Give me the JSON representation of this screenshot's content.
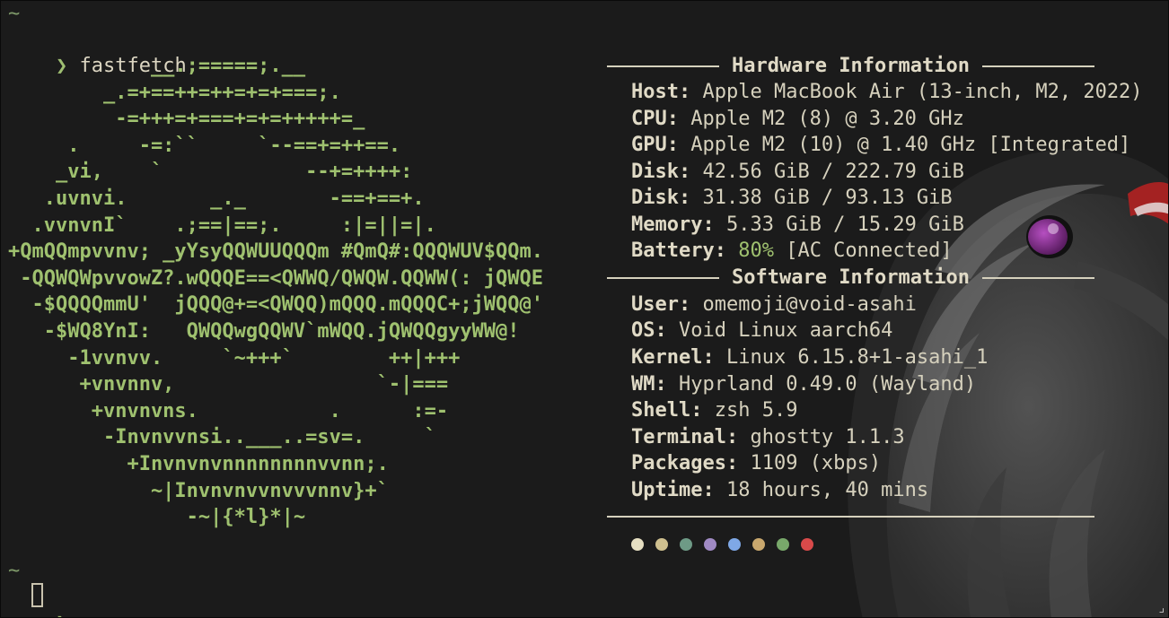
{
  "prompt": {
    "tilde": "~",
    "arrow": "❯",
    "command": "fastfetch"
  },
  "ascii_logo": [
    "            __.;=====;.__",
    "        _.=+==++=++=+=+===;.",
    "         -=+++=+===+=+=+++++=_",
    "     .     -=:``     `--==+=++==.",
    "    _vi,    `            --+=++++:",
    "   .uvnvi.       _._       -==+==+.",
    "  .vvnvnI`    .;==|==;.     :|=||=|.",
    "+QmQQmpvvnv; _yYsyQQWUUQQQm #QmQ#:QQQWUV$QQm.",
    " -QQWQWpvvowZ?.wQQQE==<QWWQ/QWQW.QQWW(: jQWQE",
    "  -$QQQQmmU'  jQQQ@+=<QWQQ)mQQQ.mQQQC+;jWQQ@'",
    "   -$WQ8YnI:   QWQQwgQQWV`mWQQ.jQWQQgyyWW@!",
    "     -1vvnvv.     `~+++`        ++|+++",
    "      +vnvnnv,                 `-|===",
    "       +vnvnvns.           .      :=-",
    "        -Invnvvnsi..___..=sv=.     `",
    "          +Invnvnvnnnnnnnnvvnn;.",
    "            ~|Invnvnvvnvvvnnv}+`",
    "               -~|{*l}*|~"
  ],
  "hardware": {
    "header": "Hardware Information",
    "rows": [
      {
        "key": "Host:",
        "value": " Apple MacBook Air (13-inch, M2, 2022)"
      },
      {
        "key": "CPU:",
        "value": " Apple M2 (8) @ 3.20 GHz"
      },
      {
        "key": "GPU:",
        "value": " Apple M2 (10) @ 1.40 GHz [Integrated]"
      },
      {
        "key": "Disk:",
        "value": " 42.56 GiB / 222.79 GiB"
      },
      {
        "key": "Disk:",
        "value": " 31.38 GiB / 93.13 GiB"
      },
      {
        "key": "Memory:",
        "value": " 5.33 GiB / 15.29 GiB"
      }
    ],
    "battery": {
      "key": "Battery:",
      "percent": " 80%",
      "status": " [AC Connected]"
    }
  },
  "software": {
    "header": "Software Information",
    "rows": [
      {
        "key": "User:",
        "value": " omemoji@void-asahi"
      },
      {
        "key": "OS:",
        "value": " Void Linux aarch64"
      },
      {
        "key": "Kernel:",
        "value": " Linux 6.15.8+1-asahi_1"
      },
      {
        "key": "WM:",
        "value": " Hyprland 0.49.0 (Wayland)"
      },
      {
        "key": "Shell:",
        "value": " zsh 5.9"
      },
      {
        "key": "Terminal:",
        "value": " ghostty 1.1.3"
      },
      {
        "key": "Packages:",
        "value": " 1109 (xbps)"
      },
      {
        "key": "Uptime:",
        "value": " 18 hours, 40 mins"
      }
    ]
  },
  "palette": [
    "#e6dfc2",
    "#cfc08f",
    "#6e9a86",
    "#a08ac4",
    "#7fa8e6",
    "#c9a86e",
    "#78a86a",
    "#d94a4a"
  ],
  "colors": {
    "background": "#1b1b1b",
    "accent_green": "#9fc16f",
    "foreground": "#d6d1bd"
  },
  "icons": {
    "prompt_icon": "chevron-right",
    "cursor": "block-cursor-outline",
    "resize": "corner-resize-icon"
  }
}
